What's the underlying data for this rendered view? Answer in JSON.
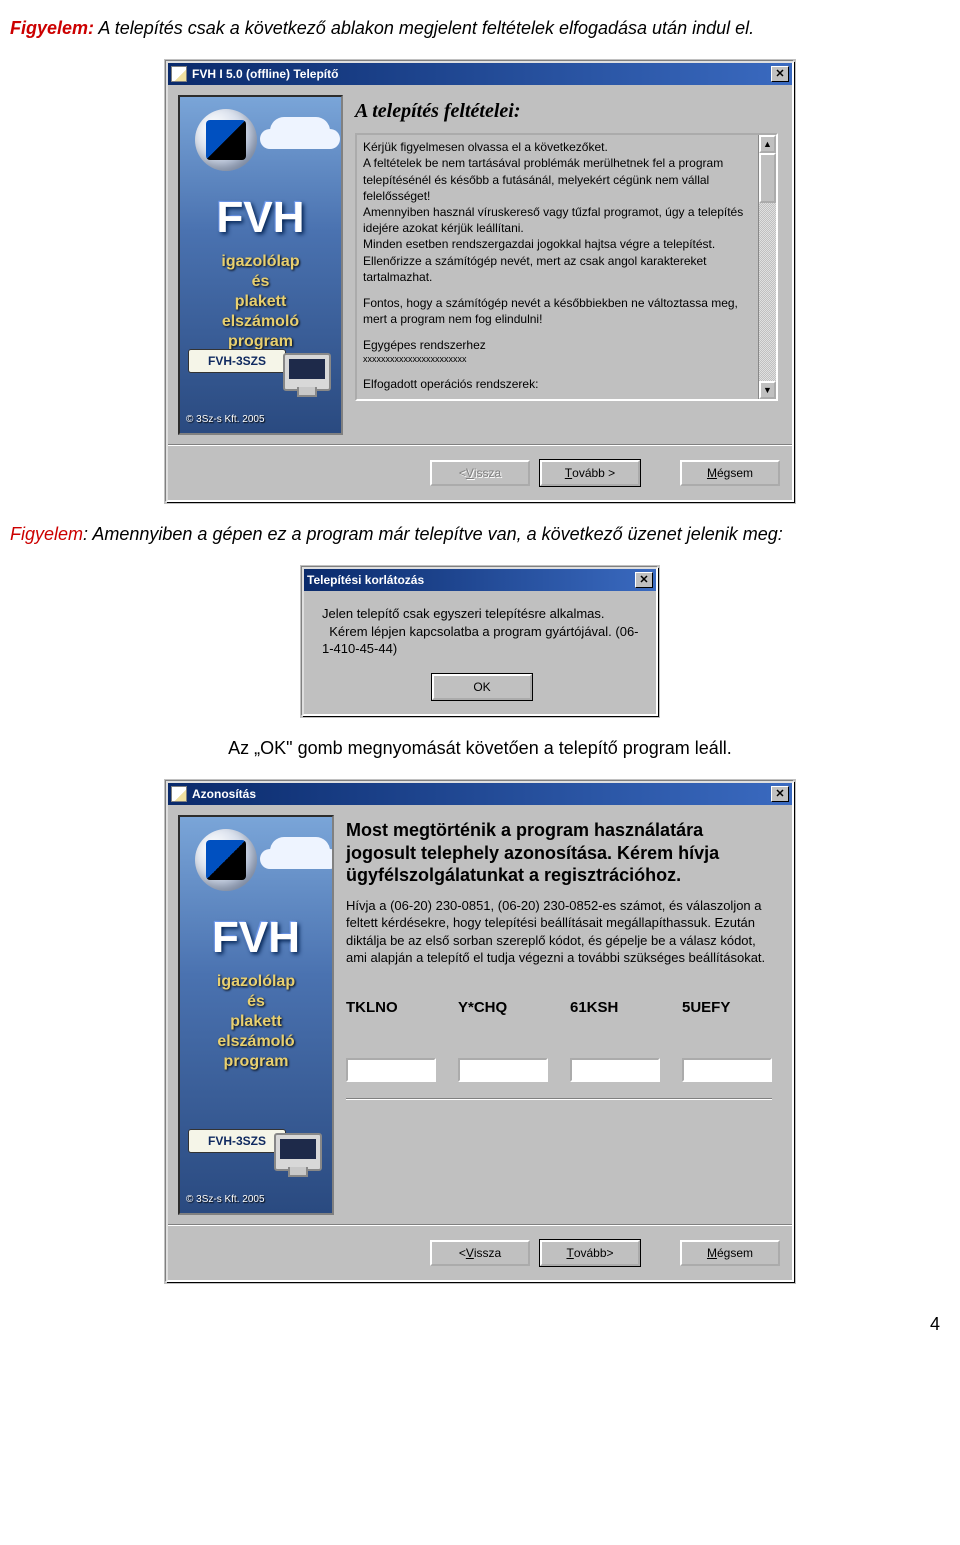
{
  "intro": {
    "prefix": "Figyelem:",
    "text": " A telepítés csak a következő ablakon megjelent feltételek elfogadása után indul el."
  },
  "window1": {
    "title": "FVH I 5.0 (offline) Telepítő",
    "section_title": "A telepítés feltételei:",
    "sidebar": {
      "logo_text": "FVH",
      "line1": "igazolólap",
      "line2": "és",
      "line3": "plakett",
      "line4": "elszámoló",
      "line5": "program",
      "plate": "FVH-3SZS",
      "copyright": "© 3Sz-s Kft.   2005"
    },
    "body": {
      "p1": "Kérjük figyelmesen olvassa el a következőket.",
      "p2": "A feltételek be nem tartásával problémák merülhetnek fel a program telepítésénél és később a futásánál, melyekért cégünk nem vállal felelősséget!",
      "p3": "Amennyiben használ víruskereső vagy tűzfal programot, úgy a telepítés idejére azokat kérjük leállítani.",
      "p4": "Minden esetben rendszergazdai jogokkal hajtsa végre a telepítést. Ellenőrizze a számítógép nevét, mert az csak angol karaktereket tartalmazhat.",
      "p5": "Fontos, hogy a számítógép nevét a későbbiekben ne változtassa meg, mert a program nem fog elindulni!",
      "p6": "Egygépes rendszerhez",
      "p7": "xxxxxxxxxxxxxxxxxxxxxxx",
      "p8": "Elfogadott operációs rendszerek:"
    },
    "buttons": {
      "back_pre": "< ",
      "back_mn": "V",
      "back_post": "issza",
      "next_mn": "T",
      "next_post": "ovább >",
      "cancel_mn": "M",
      "cancel_post": "égsem"
    }
  },
  "mid_para": {
    "prefix": "Figyelem",
    "text": ": Amennyiben a gépen ez a program már telepítve van, a következő üzenet jelenik meg:"
  },
  "window2": {
    "title": "Telepítési korlátozás",
    "line1": "Jelen telepítő csak egyszeri telepítésre alkalmas.",
    "line2": "  Kérem lépjen kapcsolatba a program gyártójával. (06-1-410-45-44)",
    "ok_label": "OK"
  },
  "after_msg": "Az „OK\" gomb megnyomását követően a telepítő program leáll.",
  "window3": {
    "title": "Azonosítás",
    "sidebar": {
      "logo_text": "FVH",
      "line1": "igazolólap",
      "line2": "és",
      "line3": "plakett",
      "line4": "elszámoló",
      "line5": "program",
      "plate": "FVH-3SZS",
      "copyright": "© 3Sz-s Kft.   2005"
    },
    "heading": "Most megtörténik a program használatára jogosult telephely azonosítása. Kérem hívja ügyfélszolgálatunkat a regisztrációhoz.",
    "text": "Hívja a (06-20) 230-0851, (06-20) 230-0852-es számot, és válaszoljon a feltett kérdésekre, hogy telepítési beállításait megállapíthassuk. Ezután diktálja be az első sorban szereplő kódot, és gépelje be a válasz kódot, ami alapján a telepítő el tudja végezni a további szükséges beállításokat.",
    "codes": {
      "c1": "TKLNO",
      "c2": "Y*CHQ",
      "c3": "61KSH",
      "c4": "5UEFY"
    },
    "buttons": {
      "back_pre": "<",
      "back_mn": "V",
      "back_post": "issza",
      "next_mn": "T",
      "next_post": "ovább>",
      "cancel_mn": "M",
      "cancel_post": "égsem"
    }
  },
  "page_number": "4"
}
